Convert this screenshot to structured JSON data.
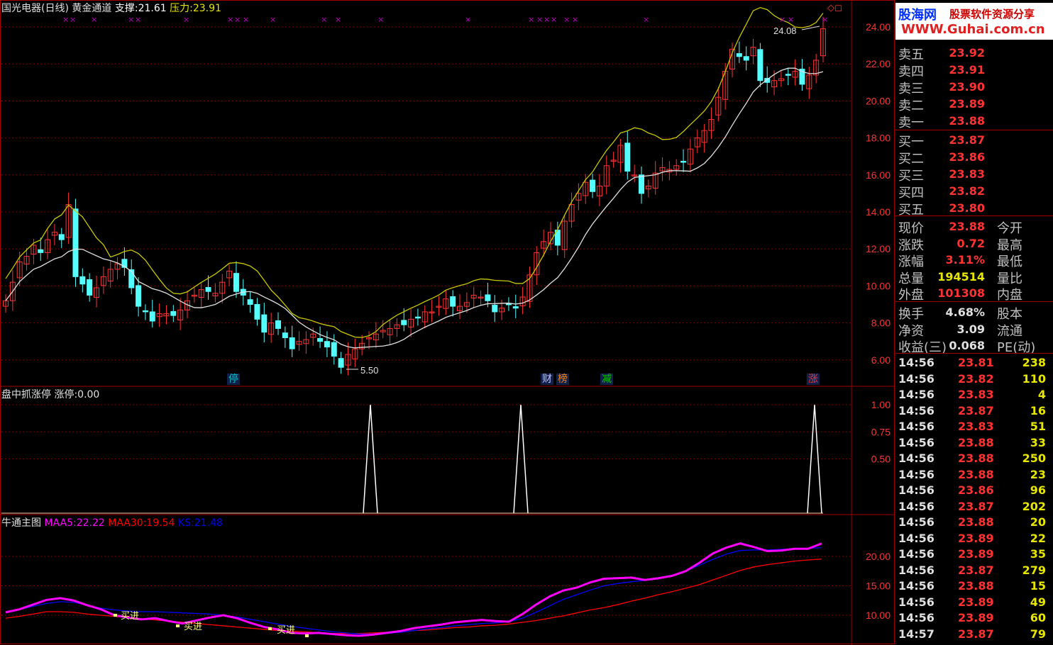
{
  "header": {
    "stock": "国光电器(日线)",
    "indicator": "黄金通道",
    "support_label": "支撑:",
    "support_value": "21.61",
    "pressure_label": "压力:",
    "pressure_value": "23.91"
  },
  "main_chart": {
    "y_ticks": [
      "24.00",
      "22.00",
      "20.00",
      "18.00",
      "16.00",
      "14.00",
      "12.00",
      "10.00",
      "8.00",
      "6.00"
    ],
    "high_marker": "24.08",
    "low_marker": "5.50",
    "event_badges": [
      {
        "text": "停",
        "color": "#00c0c0"
      },
      {
        "text": "财",
        "color": "#c0c0ff"
      },
      {
        "text": "榜",
        "color": "#ff8000"
      },
      {
        "text": "减",
        "color": "#00c000"
      },
      {
        "text": "涨",
        "color": "#ff3030"
      }
    ],
    "top_markers": [
      "×"
    ],
    "colors": {
      "up": "#ff3232",
      "down": "#54ffff",
      "upper_band": "#c8c800",
      "lower_band": "#e0e0e0"
    }
  },
  "limit_panel": {
    "title": "盘中抓涨停",
    "value_label": "涨停:",
    "value": "0.00",
    "y_ticks": [
      "1.00",
      "0.75",
      "0.50"
    ]
  },
  "bottom_panel": {
    "title": "牛通主图",
    "maa5_label": "MAA5:",
    "maa5": "22.22",
    "maa30_label": "MAA30:",
    "maa30": "19.54",
    "ks_label": "KS:",
    "ks": "21.48",
    "y_ticks": [
      "20.00",
      "15.00",
      "10.00"
    ],
    "buy_signal": "买进",
    "colors": {
      "maa5": "#ff00ff",
      "maa30": "#ff0000",
      "ks": "#0000ff"
    }
  },
  "logo": {
    "name": "股海网",
    "slogan": "股票软件资源分享",
    "url": "WWW.Guhai.com.cn"
  },
  "quote": {
    "asks": [
      {
        "label": "卖五",
        "price": "23.92"
      },
      {
        "label": "卖四",
        "price": "23.91"
      },
      {
        "label": "卖三",
        "price": "23.90"
      },
      {
        "label": "卖二",
        "price": "23.89"
      },
      {
        "label": "卖一",
        "price": "23.88"
      }
    ],
    "bids": [
      {
        "label": "买一",
        "price": "23.87"
      },
      {
        "label": "买二",
        "price": "23.86"
      },
      {
        "label": "买三",
        "price": "23.83"
      },
      {
        "label": "买四",
        "price": "23.82"
      },
      {
        "label": "买五",
        "price": "23.80"
      }
    ],
    "stats": [
      {
        "label": "现价",
        "value": "23.88",
        "color": "#ff3232",
        "label2": "今开"
      },
      {
        "label": "涨跌",
        "value": "0.72",
        "color": "#ff3232",
        "label2": "最高"
      },
      {
        "label": "涨幅",
        "value": "3.11%",
        "color": "#ff3232",
        "label2": "最低"
      },
      {
        "label": "总量",
        "value": "194514",
        "color": "#e6e600",
        "label2": "量比"
      },
      {
        "label": "外盘",
        "value": "101308",
        "color": "#ff3232",
        "label2": "内盘"
      }
    ],
    "stats2": [
      {
        "label": "换手",
        "value": "4.68%",
        "color": "#e0e0e0",
        "label2": "股本"
      },
      {
        "label": "净资",
        "value": "3.09",
        "color": "#e0e0e0",
        "label2": "流通"
      },
      {
        "label": "收益(三)",
        "value": "0.068",
        "color": "#e0e0e0",
        "label2": "PE(动)"
      }
    ]
  },
  "ticks": [
    {
      "time": "14:56",
      "price": "23.81",
      "vol": "238"
    },
    {
      "time": "14:56",
      "price": "23.82",
      "vol": "110"
    },
    {
      "time": "14:56",
      "price": "23.83",
      "vol": "4"
    },
    {
      "time": "14:56",
      "price": "23.87",
      "vol": "16"
    },
    {
      "time": "14:56",
      "price": "23.83",
      "vol": "51"
    },
    {
      "time": "14:56",
      "price": "23.88",
      "vol": "33"
    },
    {
      "time": "14:56",
      "price": "23.88",
      "vol": "250"
    },
    {
      "time": "14:56",
      "price": "23.88",
      "vol": "23"
    },
    {
      "time": "14:56",
      "price": "23.86",
      "vol": "96"
    },
    {
      "time": "14:56",
      "price": "23.87",
      "vol": "202"
    },
    {
      "time": "14:56",
      "price": "23.88",
      "vol": "20"
    },
    {
      "time": "14:56",
      "price": "23.89",
      "vol": "22"
    },
    {
      "time": "14:56",
      "price": "23.89",
      "vol": "35"
    },
    {
      "time": "14:56",
      "price": "23.87",
      "vol": "279"
    },
    {
      "time": "14:56",
      "price": "23.88",
      "vol": "15"
    },
    {
      "time": "14:56",
      "price": "23.89",
      "vol": "49"
    },
    {
      "time": "14:56",
      "price": "23.89",
      "vol": "60"
    },
    {
      "time": "14:57",
      "price": "23.87",
      "vol": "79"
    }
  ],
  "chart_data": [
    {
      "type": "candlestick",
      "title": "国光电器(日线)",
      "ylim": [
        5,
        25
      ],
      "series_note": "approximate daily closes",
      "close": [
        9.2,
        10.2,
        11.3,
        11.6,
        12.2,
        11.8,
        12.5,
        12.9,
        12.5,
        14.4,
        10.5,
        10.1,
        9.5,
        9.9,
        10.5,
        10.9,
        11.2,
        11.0,
        9.9,
        8.9,
        8.6,
        8.1,
        8.5,
        8.5,
        8.4,
        8.7,
        9.2,
        9.5,
        9.8,
        9.7,
        9.6,
        10.2,
        10.8,
        9.7,
        9.5,
        9.0,
        8.2,
        7.5,
        8.0,
        7.7,
        7.2,
        6.6,
        7.0,
        7.1,
        7.4,
        7.0,
        6.7,
        6.2,
        5.6,
        6.3,
        6.6,
        6.9,
        7.2,
        7.4,
        7.6,
        7.7,
        7.9,
        7.9,
        8.2,
        8.3,
        8.6,
        8.6,
        8.9,
        9.3,
        8.9,
        8.9,
        9.1,
        9.5,
        9.4,
        9.2,
        8.6,
        8.8,
        9.0,
        8.8,
        9.4,
        10.6,
        11.8,
        12.4,
        12.9,
        12.2,
        13.5,
        14.4,
        15.0,
        15.6,
        15.1,
        15.4,
        16.5,
        16.8,
        17.6,
        16.2,
        16.0,
        15.0,
        15.4,
        16.1,
        16.4,
        16.3,
        16.5,
        16.7,
        17.4,
        18.0,
        18.4,
        19.0,
        20.2,
        21.6,
        22.8,
        22.4,
        22.2,
        22.9,
        21.1,
        21.0,
        21.1,
        21.2,
        21.4,
        21.6,
        20.9,
        21.4,
        22.2,
        23.9
      ]
    },
    {
      "type": "line",
      "title": "盘中抓涨停",
      "ylim": [
        0,
        1.1
      ],
      "series": [
        {
          "name": "涨停",
          "spikes_at_index": [
            48,
            68,
            109
          ],
          "value": 1.0
        }
      ]
    },
    {
      "type": "line",
      "title": "牛通主图",
      "ylim": [
        6,
        24
      ],
      "series": [
        {
          "name": "MAA5",
          "values": [
            10.5,
            11.0,
            11.8,
            12.6,
            12.9,
            12.5,
            11.7,
            11.0,
            10.0,
            9.6,
            9.3,
            9.5,
            9.0,
            8.6,
            9.1,
            9.6,
            10.0,
            9.5,
            8.7,
            8.0,
            7.6,
            7.0,
            6.9,
            7.0,
            6.8,
            6.6,
            6.5,
            6.7,
            7.0,
            7.3,
            7.8,
            8.1,
            8.4,
            8.8,
            9.0,
            9.2,
            9.0,
            8.9,
            10.2,
            11.8,
            13.2,
            14.2,
            14.7,
            15.6,
            16.2,
            16.3,
            16.4,
            16.0,
            16.3,
            16.7,
            17.5,
            18.9,
            20.5,
            21.5,
            22.2,
            21.6,
            20.9,
            21.0,
            21.3,
            21.3,
            22.2
          ]
        },
        {
          "name": "MAA30",
          "values": [
            9.5,
            9.8,
            10.2,
            10.6,
            10.6,
            10.5,
            10.2,
            10.0,
            9.8,
            9.6,
            9.4,
            9.2,
            9.0,
            8.8,
            8.6,
            8.4,
            8.2,
            8.0,
            7.8,
            7.6,
            7.4,
            7.3,
            7.2,
            7.0,
            6.9,
            6.9,
            6.9,
            7.0,
            7.1,
            7.2,
            7.4,
            7.5,
            7.7,
            7.9,
            8.0,
            8.2,
            8.3,
            8.5,
            8.8,
            9.1,
            9.5,
            9.9,
            10.4,
            10.9,
            11.3,
            11.8,
            12.4,
            12.9,
            13.5,
            14.0,
            14.6,
            15.2,
            16.0,
            16.8,
            17.6,
            18.2,
            18.6,
            18.9,
            19.2,
            19.4,
            19.54
          ]
        },
        {
          "name": "KS",
          "values": [
            10.5,
            11.0,
            11.5,
            12.0,
            12.3,
            12.2,
            11.7,
            11.2,
            10.9,
            10.7,
            10.6,
            10.6,
            10.5,
            10.4,
            10.3,
            10.2,
            10.0,
            9.7,
            9.3,
            8.9,
            8.5,
            8.1,
            7.8,
            7.5,
            7.2,
            7.0,
            6.8,
            6.8,
            6.9,
            7.1,
            7.4,
            7.7,
            7.9,
            8.2,
            8.4,
            8.6,
            8.7,
            8.9,
            9.5,
            10.5,
            11.6,
            12.7,
            13.5,
            14.3,
            15.0,
            15.4,
            15.7,
            15.9,
            16.3,
            16.8,
            17.5,
            18.5,
            19.5,
            20.4,
            21.0,
            21.1,
            21.1,
            21.2,
            21.3,
            21.4,
            21.48
          ]
        }
      ]
    }
  ]
}
